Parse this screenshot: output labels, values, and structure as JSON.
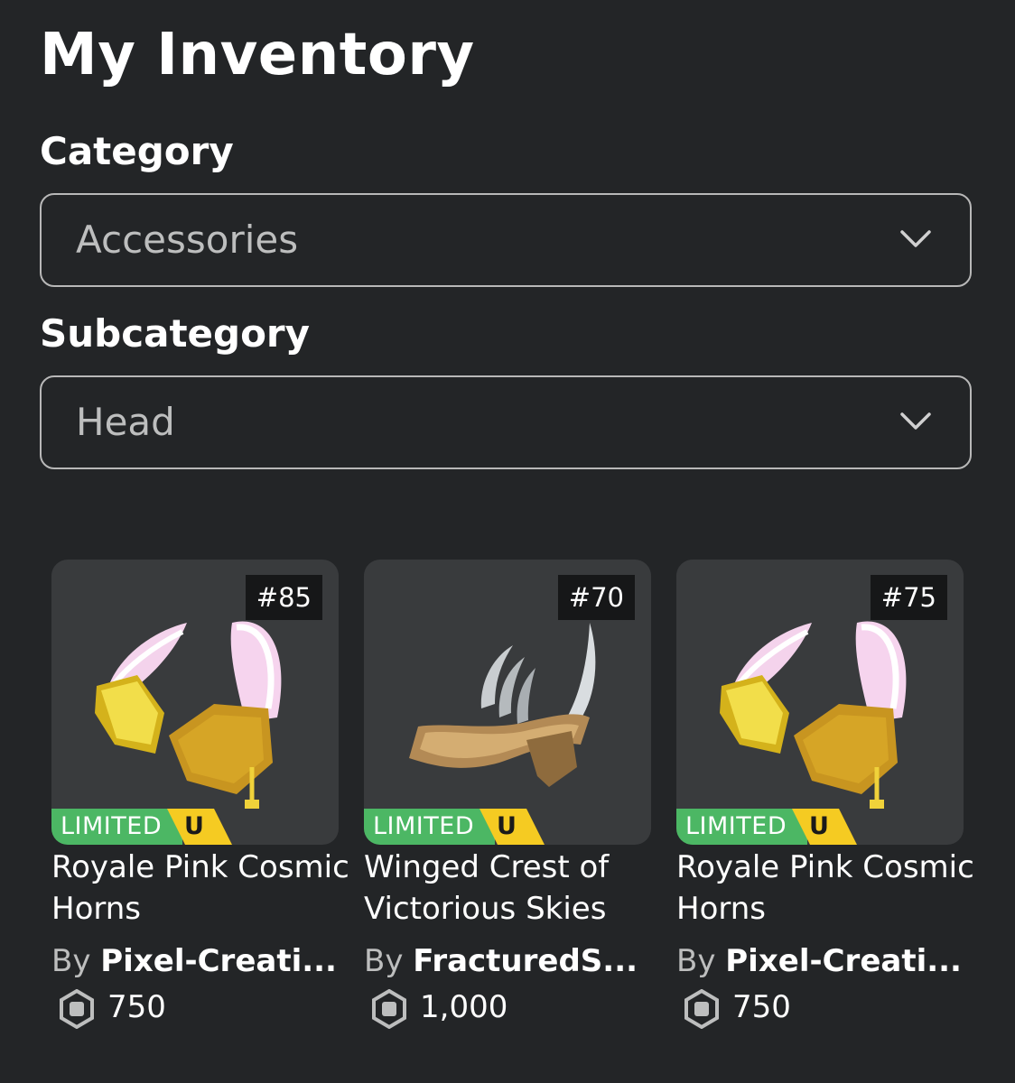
{
  "page": {
    "title": "My Inventory"
  },
  "filters": {
    "category_label": "Category",
    "category_value": "Accessories",
    "subcategory_label": "Subcategory",
    "subcategory_value": "Head"
  },
  "items": [
    {
      "serial": "#85",
      "badge": "LIMITED",
      "badge_tag": "U",
      "name": "Royale Pink Cosmic Horns",
      "by": "By",
      "creator": "Pixel-Creati...",
      "price": "750",
      "icon": "robux-icon"
    },
    {
      "serial": "#70",
      "badge": "LIMITED",
      "badge_tag": "U",
      "name": "Winged Crest of Victorious Skies",
      "by": "By",
      "creator": "FracturedS...",
      "price": "1,000",
      "icon": "robux-icon"
    },
    {
      "serial": "#75",
      "badge": "LIMITED",
      "badge_tag": "U",
      "name": "Royale Pink Cosmic Horns",
      "by": "By",
      "creator": "Pixel-Creati...",
      "price": "750",
      "icon": "robux-icon"
    }
  ],
  "colors": {
    "background": "#232527",
    "card": "#393b3d",
    "limited_green": "#4cb764",
    "unique_yellow": "#f5cb22"
  }
}
